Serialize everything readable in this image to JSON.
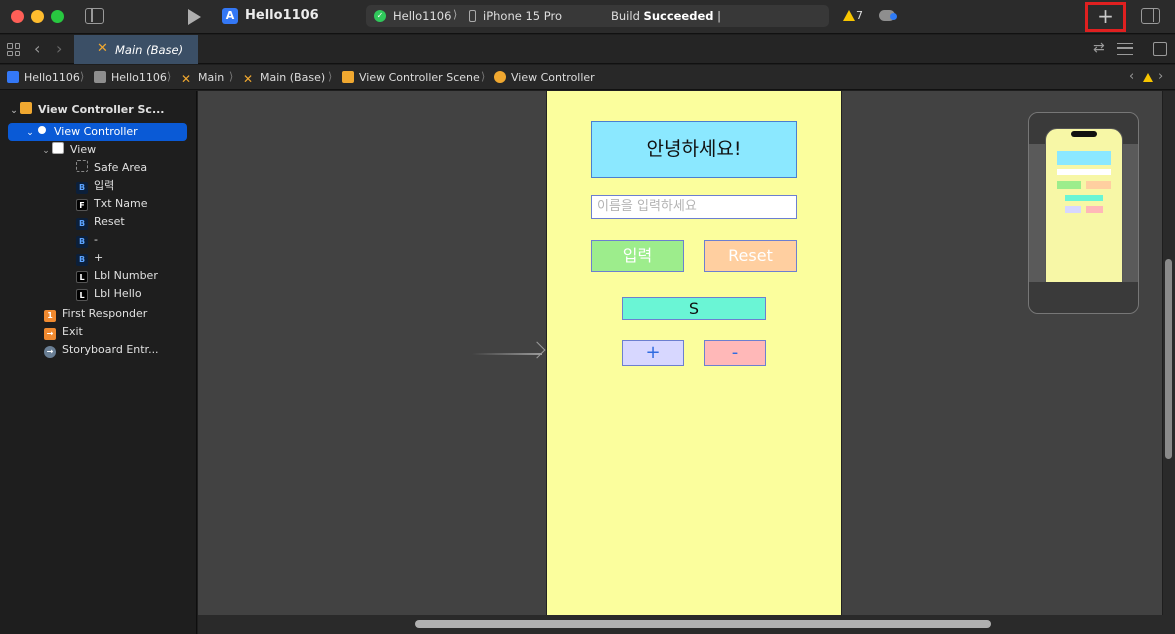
{
  "titlebar": {
    "project_name": "Hello1106",
    "scheme": "Hello1106",
    "scheme_separator": "⟩",
    "device": "iPhone 15 Pro",
    "build_status_prefix": "Build",
    "build_status_word": "Succeeded",
    "warning_count": "7",
    "add_label": "+"
  },
  "tabbar": {
    "active_tab": "Main (Base)"
  },
  "breadcrumb": [
    "Hello1106",
    "Hello1106",
    "Main",
    "Main (Base)",
    "View Controller Scene",
    "View Controller"
  ],
  "outline": {
    "scene": "View Controller Sc...",
    "view_controller": "View Controller",
    "view": "View",
    "children": [
      "Safe Area",
      "입력",
      "Txt Name",
      "Reset",
      "-",
      "+",
      "Lbl Number",
      "Lbl Hello"
    ],
    "first_responder": "First Responder",
    "exit": "Exit",
    "storyboard_entry": "Storyboard Entr..."
  },
  "canvas": {
    "lbl_hello": "안녕하세요!",
    "txt_name_placeholder": "이름을 입력하세요",
    "btn_input": "입력",
    "btn_reset": "Reset",
    "lbl_number": "S",
    "btn_plus": "+",
    "btn_minus": "-"
  },
  "colors": {
    "phone_bg": "#fbfe9d",
    "lbl_hello_bg": "#8be8ff",
    "btn_input_bg": "#9ded8c",
    "btn_reset_bg": "#ffcfa0",
    "lbl_number_bg": "#6af5d5",
    "btn_plus_bg": "#d7d7ff",
    "btn_minus_bg": "#ffb8b8",
    "selection": "#0a5ad6",
    "highlight_box": "#e02020"
  }
}
